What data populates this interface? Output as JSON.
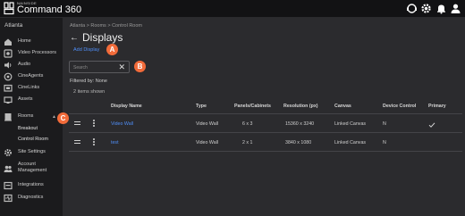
{
  "header": {
    "brand_small": "NAINSIDE",
    "brand_name": "Command 360",
    "icons": [
      "support-icon",
      "settings-icon",
      "notifications-icon",
      "user-icon"
    ]
  },
  "sidebar": {
    "site": "Atlanta",
    "items": [
      {
        "label": "Home",
        "icon": "home-icon"
      },
      {
        "label": "Video Processors",
        "icon": "video-processor-icon"
      },
      {
        "label": "Audio",
        "icon": "audio-icon"
      },
      {
        "label": "CineAgents",
        "icon": "cineagents-icon"
      },
      {
        "label": "CineLinks",
        "icon": "cinelinks-icon"
      },
      {
        "label": "Assets",
        "icon": "assets-icon"
      },
      {
        "label": "Rooms",
        "icon": "rooms-icon"
      },
      {
        "label": "Site Settings",
        "icon": "site-settings-icon"
      },
      {
        "label": "Account Management",
        "icon": "account-management-icon"
      },
      {
        "label": "Integrations",
        "icon": "integrations-icon"
      },
      {
        "label": "Diagnostics",
        "icon": "diagnostics-icon"
      }
    ],
    "rooms_sub": [
      "Breakout",
      "Control Room"
    ]
  },
  "main": {
    "breadcrumb": "Atlanta  >  Rooms  >  Control Room",
    "title": "Displays",
    "add_label": "Add Display",
    "search_placeholder": "Search",
    "filtered_by": "Filtered by: None",
    "items_shown": "2 items shown"
  },
  "callouts": {
    "a": "A",
    "b": "B",
    "c": "C"
  },
  "table": {
    "headers": {
      "name": "Display Name",
      "type": "Type",
      "panels": "Panels/Cabinets",
      "resolution": "Resolution (px)",
      "canvas": "Canvas",
      "device_control": "Device Control",
      "primary": "Primary"
    },
    "rows": [
      {
        "name": "Video Wall",
        "type": "Video Wall",
        "panels": "6 x 3",
        "resolution": "15360 x 3240",
        "canvas": "Linked Canvas",
        "device_control": "N",
        "primary": true
      },
      {
        "name": "test",
        "type": "Video Wall",
        "panels": "2 x 1",
        "resolution": "3840 x 1080",
        "canvas": "Linked Canvas",
        "device_control": "N",
        "primary": false
      }
    ]
  },
  "colors": {
    "accent": "#4f8ef7",
    "callout": "#f26b3a",
    "background": "#2b2b2e",
    "sidebar": "#1b1b1d"
  }
}
